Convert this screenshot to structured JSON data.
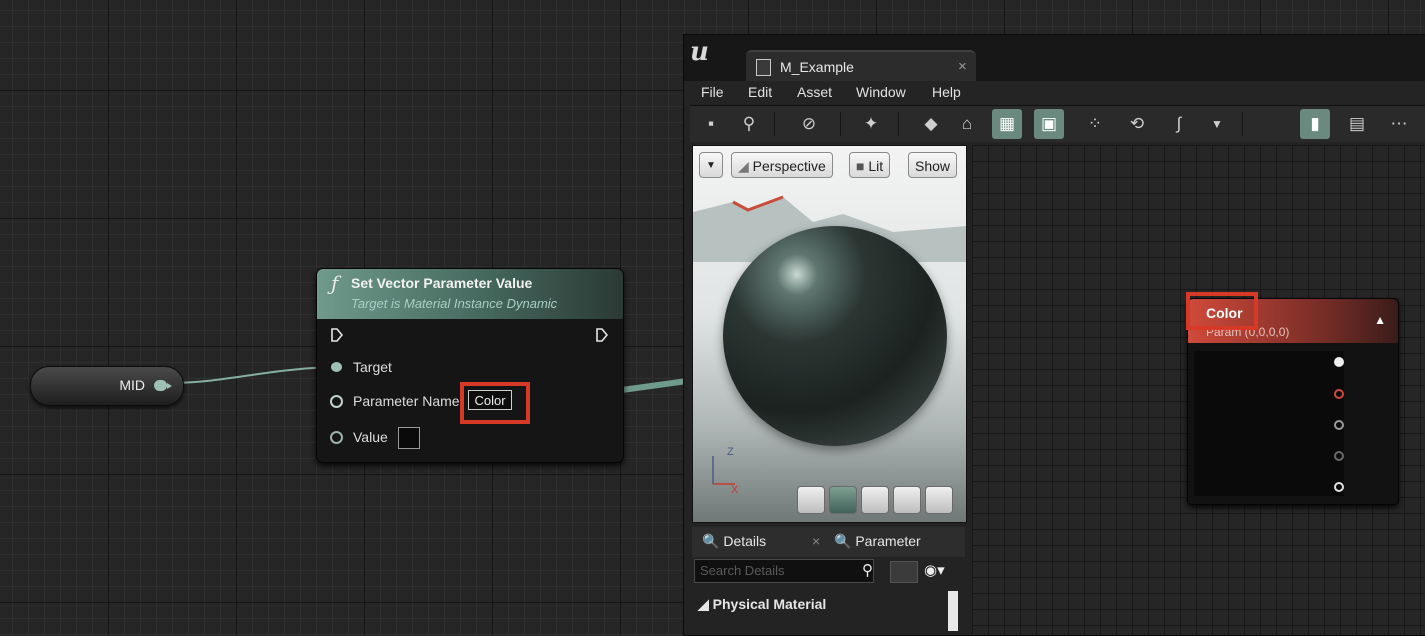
{
  "blueprint": {
    "variable_node": {
      "label": "MID"
    },
    "function_node": {
      "title": "Set Vector Parameter Value",
      "subtitle": "Target is Material Instance Dynamic",
      "pins": {
        "target": "Target",
        "parameter_name": "Parameter Name",
        "parameter_value": "Color",
        "value": "Value"
      }
    }
  },
  "editor": {
    "tab_title": "M_Example",
    "menu": [
      "File",
      "Edit",
      "Asset",
      "Window",
      "Help"
    ],
    "viewport": {
      "view_mode": "Perspective",
      "lighting": "Lit",
      "show": "Show",
      "axes": {
        "z": "Z",
        "x": "X"
      }
    },
    "details_tabs": [
      "Details",
      "Parameter"
    ],
    "search_placeholder": "Search Details",
    "category": "Physical Material"
  },
  "material_node": {
    "title": "Color",
    "subtitle": "Param (0,0,0,0)"
  },
  "colors": {
    "highlight": "#d63a26",
    "wire": "#6f9a8c",
    "node_header_teal": "#6f9a8c",
    "param_header_red": "#d04a3a"
  }
}
